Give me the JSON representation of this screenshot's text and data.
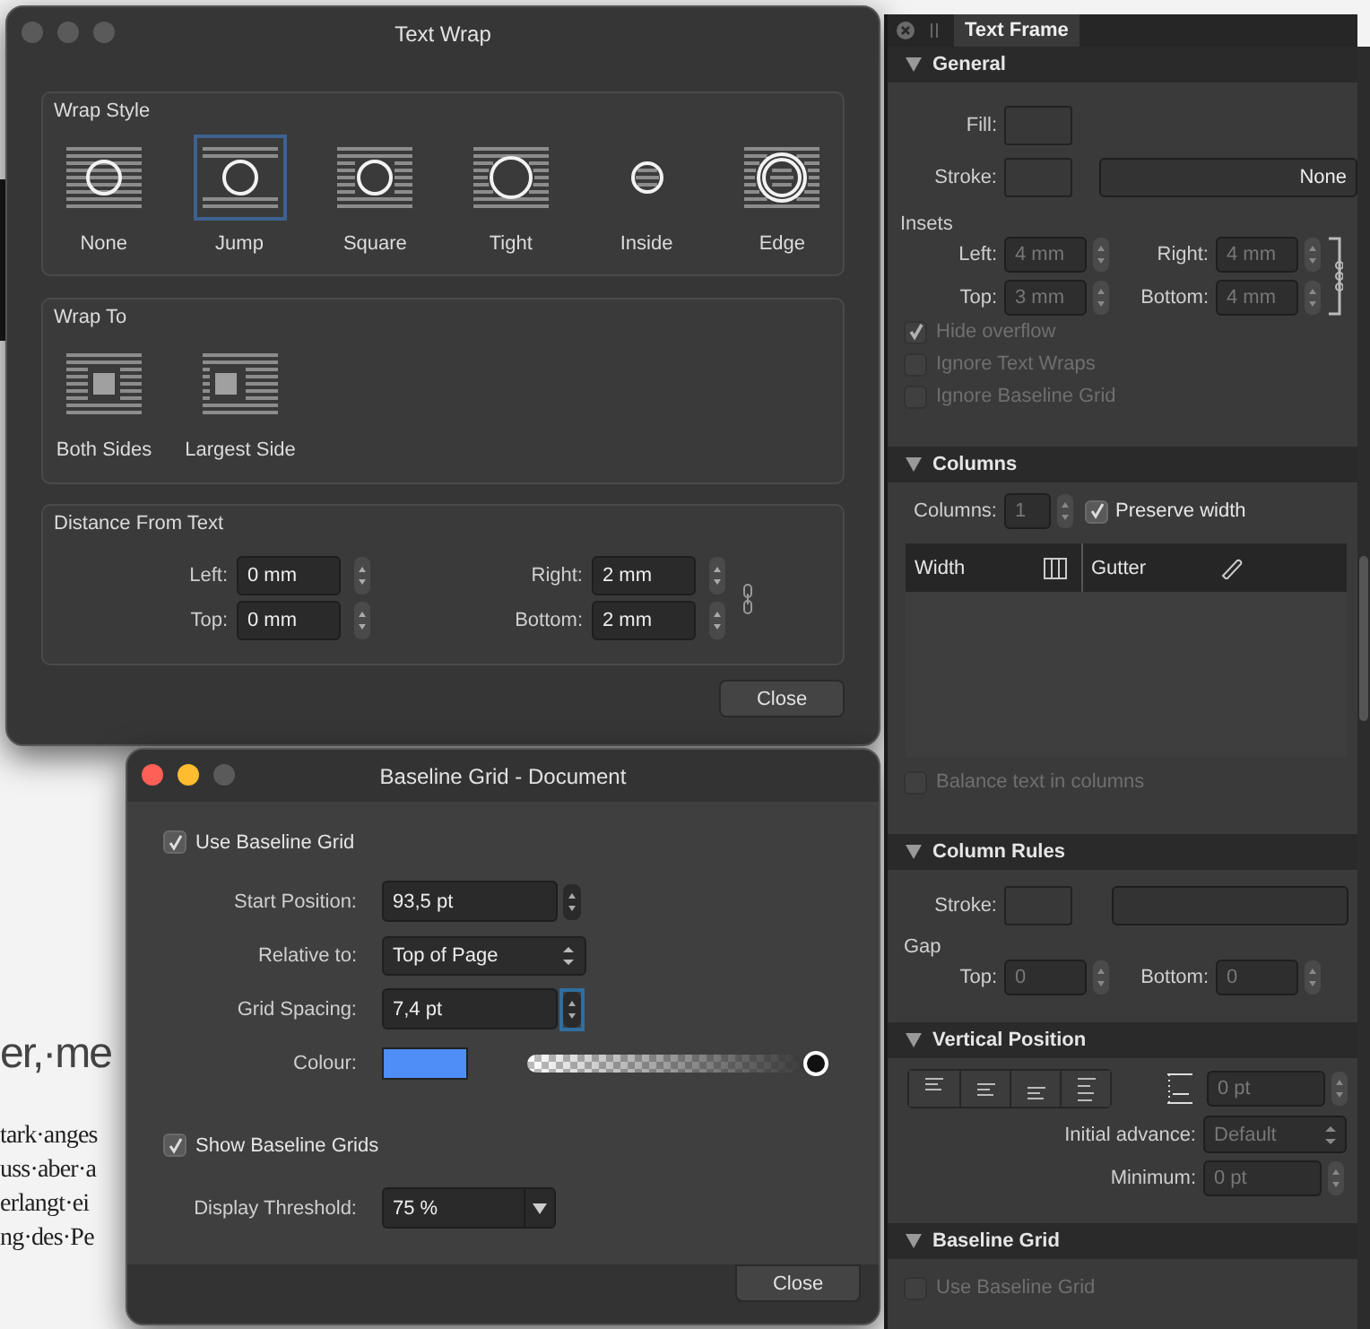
{
  "document": {
    "lines": [
      {
        "text": "er,·me",
        "kind": "heading"
      },
      {
        "text": "tark·anges",
        "kind": "body"
      },
      {
        "text": "uss·aber·a",
        "kind": "body"
      },
      {
        "text": "erlangt·ei",
        "kind": "body"
      },
      {
        "text": "ng·des·Pe",
        "kind": "body"
      }
    ]
  },
  "text_wrap": {
    "title": "Text Wrap",
    "wrap_style": {
      "label": "Wrap Style",
      "options": [
        {
          "label": "None",
          "kind": "none",
          "selected": false
        },
        {
          "label": "Jump",
          "kind": "jump",
          "selected": true
        },
        {
          "label": "Square",
          "kind": "square",
          "selected": false
        },
        {
          "label": "Tight",
          "kind": "tight",
          "selected": false
        },
        {
          "label": "Inside",
          "kind": "inside",
          "selected": false
        },
        {
          "label": "Edge",
          "kind": "edge",
          "selected": false
        }
      ]
    },
    "wrap_to": {
      "label": "Wrap To",
      "options": [
        {
          "label": "Both Sides",
          "kind": "both",
          "selected": false
        },
        {
          "label": "Largest Side",
          "kind": "largest",
          "selected": false
        }
      ]
    },
    "distance": {
      "label": "Distance From Text",
      "fields": [
        {
          "label": "Left:",
          "value": "0 mm"
        },
        {
          "label": "Right:",
          "value": "2 mm"
        },
        {
          "label": "Top:",
          "value": "0 mm"
        },
        {
          "label": "Bottom:",
          "value": "2 mm"
        }
      ]
    },
    "close": "Close"
  },
  "baseline_grid": {
    "title": "Baseline Grid - Document",
    "use": {
      "label": "Use Baseline Grid",
      "checked": true
    },
    "start_position": {
      "label": "Start Position:",
      "value": "93,5 pt",
      "focused": false
    },
    "relative_to": {
      "label": "Relative to:",
      "value": "Top of Page"
    },
    "grid_spacing": {
      "label": "Grid Spacing:",
      "value": "7,4 pt",
      "focused": true
    },
    "colour": {
      "label": "Colour:",
      "color": "#4f8ef7",
      "level": 1
    },
    "show": {
      "label": "Show Baseline Grids",
      "checked": true
    },
    "display_threshold": {
      "label": "Display Threshold:",
      "value": "75 %"
    },
    "close": "Close"
  },
  "panel": {
    "tab": {
      "label": "Text Frame",
      "selected": true
    },
    "general": {
      "title": "General",
      "expanded": true,
      "fill": {
        "label": "Fill:"
      },
      "stroke": {
        "label": "Stroke:",
        "value": "None"
      },
      "insets": {
        "label": "Insets",
        "fields": [
          {
            "label": "Left:",
            "value": "4 mm",
            "disabled": true
          },
          {
            "label": "Right:",
            "value": "4 mm",
            "disabled": true
          },
          {
            "label": "Top:",
            "value": "3 mm",
            "disabled": true
          },
          {
            "label": "Bottom:",
            "value": "4 mm",
            "disabled": true
          }
        ]
      },
      "options": [
        {
          "label": "Hide overflow",
          "checked": true,
          "disabled": true
        },
        {
          "label": "Ignore Text Wraps",
          "checked": false,
          "disabled": true
        },
        {
          "label": "Ignore Baseline Grid",
          "checked": false,
          "disabled": true
        }
      ]
    },
    "columns": {
      "title": "Columns",
      "expanded": true,
      "count": {
        "label": "Columns:",
        "value": "1",
        "disabled": true
      },
      "preserve": {
        "label": "Preserve width",
        "checked": true,
        "disabled": false
      },
      "table_columns": [
        "Width",
        "Gutter"
      ],
      "balance": {
        "label": "Balance text in columns",
        "checked": false,
        "disabled": true
      }
    },
    "column_rules": {
      "title": "Column Rules",
      "expanded": true,
      "stroke": {
        "label": "Stroke:"
      },
      "gap": {
        "label": "Gap",
        "fields": [
          {
            "label": "Top:",
            "value": "0",
            "disabled": true
          },
          {
            "label": "Bottom:",
            "value": "0",
            "disabled": true
          }
        ]
      }
    },
    "vertical_position": {
      "title": "Vertical Position",
      "expanded": true,
      "alignments": [
        {
          "kind": "top"
        },
        {
          "kind": "center"
        },
        {
          "kind": "bottom"
        },
        {
          "kind": "justify"
        }
      ],
      "offset": {
        "value": "0 pt",
        "disabled": true
      },
      "initial_advance": {
        "label": "Initial advance:",
        "value": "Default",
        "disabled": true
      },
      "minimum": {
        "label": "Minimum:",
        "value": "0 pt",
        "disabled": true
      }
    },
    "baseline_grid": {
      "title": "Baseline Grid",
      "expanded": true,
      "use": {
        "label": "Use Baseline Grid",
        "checked": false,
        "disabled": true
      }
    }
  }
}
